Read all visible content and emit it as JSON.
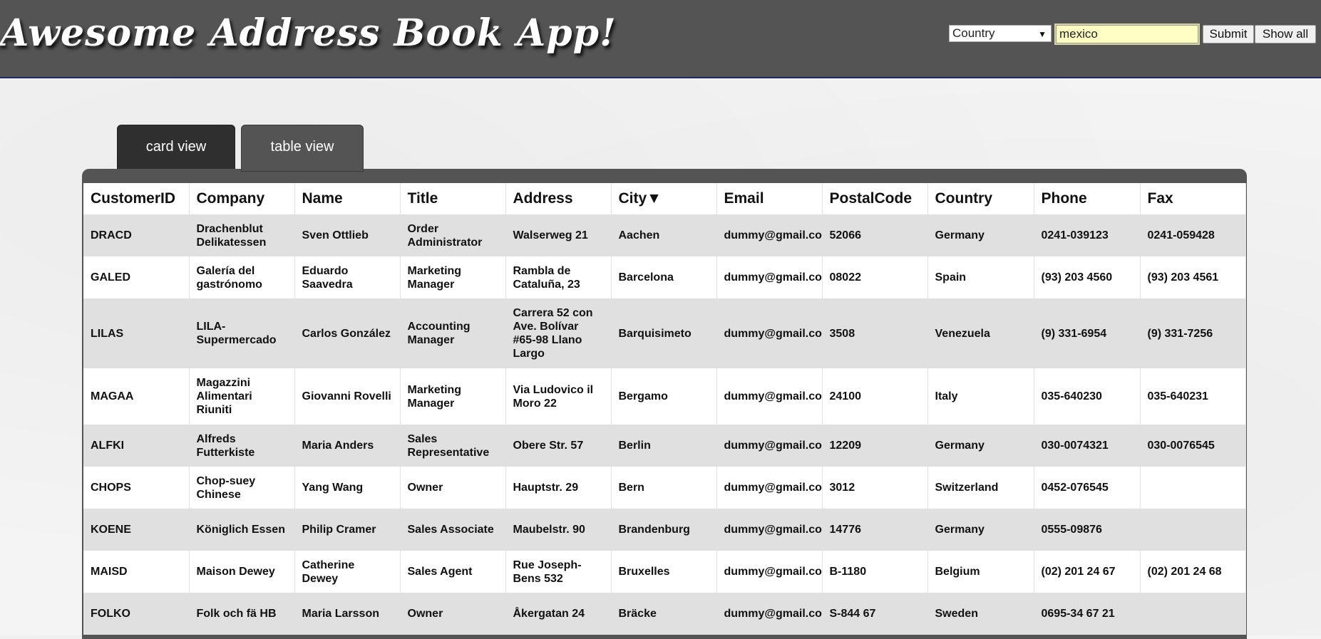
{
  "app": {
    "title": "Awesome Address Book App!"
  },
  "search": {
    "field_select": "Country",
    "query_value": "mexico",
    "submit_label": "Submit",
    "show_all_label": "Show all"
  },
  "tabs": [
    {
      "label": "card view",
      "active": false
    },
    {
      "label": "table view",
      "active": true
    }
  ],
  "table": {
    "columns": [
      "CustomerID",
      "Company",
      "Name",
      "Title",
      "Address",
      "City▼",
      "Email",
      "PostalCode",
      "Country",
      "Phone",
      "Fax"
    ],
    "sorted_column": "City",
    "rows": [
      [
        "DRACD",
        "Drachenblut Delikatessen",
        "Sven Ottlieb",
        "Order Administrator",
        "Walserweg 21",
        "Aachen",
        "dummy@gmail.com",
        "52066",
        "Germany",
        "0241-039123",
        "0241-059428"
      ],
      [
        "GALED",
        "Galería del gastrónomo",
        "Eduardo Saavedra",
        "Marketing Manager",
        "Rambla de Cataluña, 23",
        "Barcelona",
        "dummy@gmail.com",
        "08022",
        "Spain",
        "(93) 203 4560",
        "(93) 203 4561"
      ],
      [
        "LILAS",
        "LILA-Supermercado",
        "Carlos González",
        "Accounting Manager",
        "Carrera 52 con Ave. Bolívar #65-98 Llano Largo",
        "Barquisimeto",
        "dummy@gmail.com",
        "3508",
        "Venezuela",
        "(9) 331-6954",
        "(9) 331-7256"
      ],
      [
        "MAGAA",
        "Magazzini Alimentari Riuniti",
        "Giovanni Rovelli",
        "Marketing Manager",
        "Via Ludovico il Moro 22",
        "Bergamo",
        "dummy@gmail.com",
        "24100",
        "Italy",
        "035-640230",
        "035-640231"
      ],
      [
        "ALFKI",
        "Alfreds Futterkiste",
        "Maria Anders",
        "Sales Representative",
        "Obere Str. 57",
        "Berlin",
        "dummy@gmail.com",
        "12209",
        "Germany",
        "030-0074321",
        "030-0076545"
      ],
      [
        "CHOPS",
        "Chop-suey Chinese",
        "Yang Wang",
        "Owner",
        "Hauptstr. 29",
        "Bern",
        "dummy@gmail.com",
        "3012",
        "Switzerland",
        "0452-076545",
        ""
      ],
      [
        "KOENE",
        "Königlich Essen",
        "Philip Cramer",
        "Sales Associate",
        "Maubelstr. 90",
        "Brandenburg",
        "dummy@gmail.com",
        "14776",
        "Germany",
        "0555-09876",
        ""
      ],
      [
        "MAISD",
        "Maison Dewey",
        "Catherine Dewey",
        "Sales Agent",
        "Rue Joseph-Bens 532",
        "Bruxelles",
        "dummy@gmail.com",
        "B-1180",
        "Belgium",
        "(02) 201 24 67",
        "(02) 201 24 68"
      ],
      [
        "FOLKO",
        "Folk och fä HB",
        "Maria Larsson",
        "Owner",
        "Åkergatan 24",
        "Bräcke",
        "dummy@gmail.com",
        "S-844 67",
        "Sweden",
        "0695-34 67 21",
        ""
      ]
    ]
  },
  "colors": {
    "header_bg": "#545454",
    "active_tab_bg": "#545454",
    "inactive_tab_bg": "#2f2f2f",
    "search_input_bg": "#ffffc4",
    "row_stripe": "#e0e0e0"
  }
}
